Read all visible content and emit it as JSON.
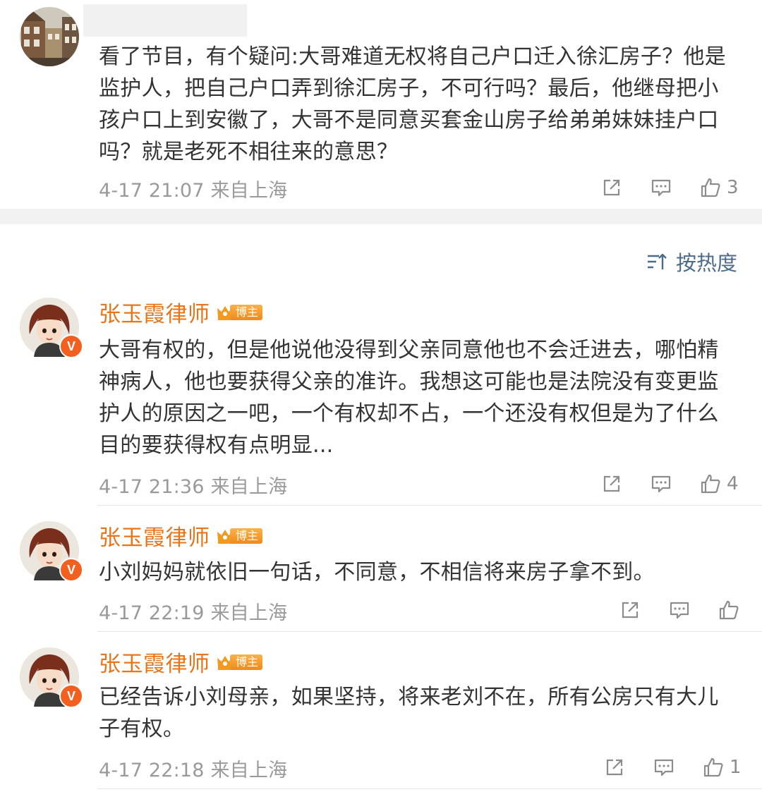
{
  "top_comment": {
    "text": "看了节目，有个疑问:大哥难道无权将自己户口迁入徐汇房子？他是监护人，把自己户口弄到徐汇房子，不可行吗？最后，他继母把小孩户口上到安徽了，大哥不是同意买套金山房子给弟弟妹妹挂户口吗？就是老死不相往来的意思？",
    "time": "4-17 21:07",
    "location": "来自上海",
    "likes": "3"
  },
  "sort": {
    "label": "按热度",
    "icon": "sort-icon"
  },
  "badge": {
    "label": "博主",
    "icon": "crown-icon"
  },
  "replies": [
    {
      "author": "张玉霞律师",
      "text": "大哥有权的，但是他说他没得到父亲同意他也不会迁进去，哪怕精神病人，他也要获得父亲的准许。我想这可能也是法院没有变更监护人的原因之一吧，一个有权却不占，一个还没有权但是为了什么目的要获得权有点明显...",
      "time": "4-17 21:36",
      "location": "来自上海",
      "likes": "4"
    },
    {
      "author": "张玉霞律师",
      "text": "小刘妈妈就依旧一句话，不同意，不相信将来房子拿不到。",
      "time": "4-17 22:19",
      "location": "来自上海",
      "likes": ""
    },
    {
      "author": "张玉霞律师",
      "text": "已经告诉小刘母亲，如果坚持，将来老刘不在，所有公房只有大儿子有权。",
      "time": "4-17 22:18",
      "location": "来自上海",
      "likes": "1"
    }
  ],
  "colors": {
    "author": "#e8751a",
    "sort": "#4c6a8a",
    "meta": "#9a9a9a",
    "verified": "#f25f1f"
  }
}
